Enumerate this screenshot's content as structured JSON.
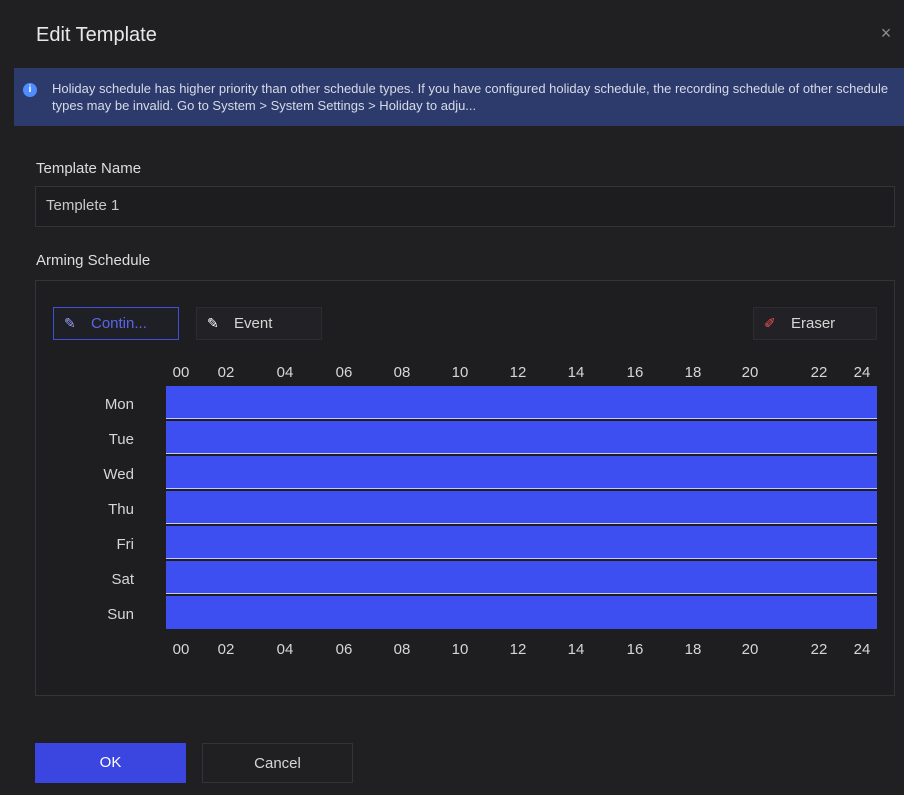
{
  "dialog": {
    "title": "Edit Template",
    "close_symbol": "×",
    "notice": {
      "icon": "info-icon",
      "icon_glyph": "i",
      "text": "Holiday schedule has higher priority than other schedule types. If you have configured holiday schedule, the recording schedule of other schedule types may be invalid. Go to System > System Settings > Holiday to adju..."
    },
    "template_name": {
      "label": "Template Name",
      "value": "Templete 1"
    },
    "arming_schedule": {
      "label": "Arming Schedule",
      "tools": [
        {
          "label": "Contin...",
          "icon": "brush-icon",
          "glyph": "✎"
        },
        {
          "label": "Event",
          "icon": "brush-icon",
          "glyph": "✎"
        },
        {
          "label": "Eraser",
          "icon": "eraser-icon",
          "glyph": "✐"
        }
      ],
      "hours": [
        "00",
        "02",
        "04",
        "06",
        "08",
        "10",
        "12",
        "14",
        "16",
        "18",
        "20",
        "22",
        "24"
      ],
      "days": [
        "Mon",
        "Tue",
        "Wed",
        "Thu",
        "Fri",
        "Sat",
        "Sun"
      ],
      "schedule_fill_color": "#3d4ff0",
      "schedule_coverage_percent": 100
    },
    "buttons": {
      "ok": "OK",
      "cancel": "Cancel"
    },
    "colors": {
      "accent": "#3b45df",
      "notice_bg": "#2d3a6c"
    }
  }
}
